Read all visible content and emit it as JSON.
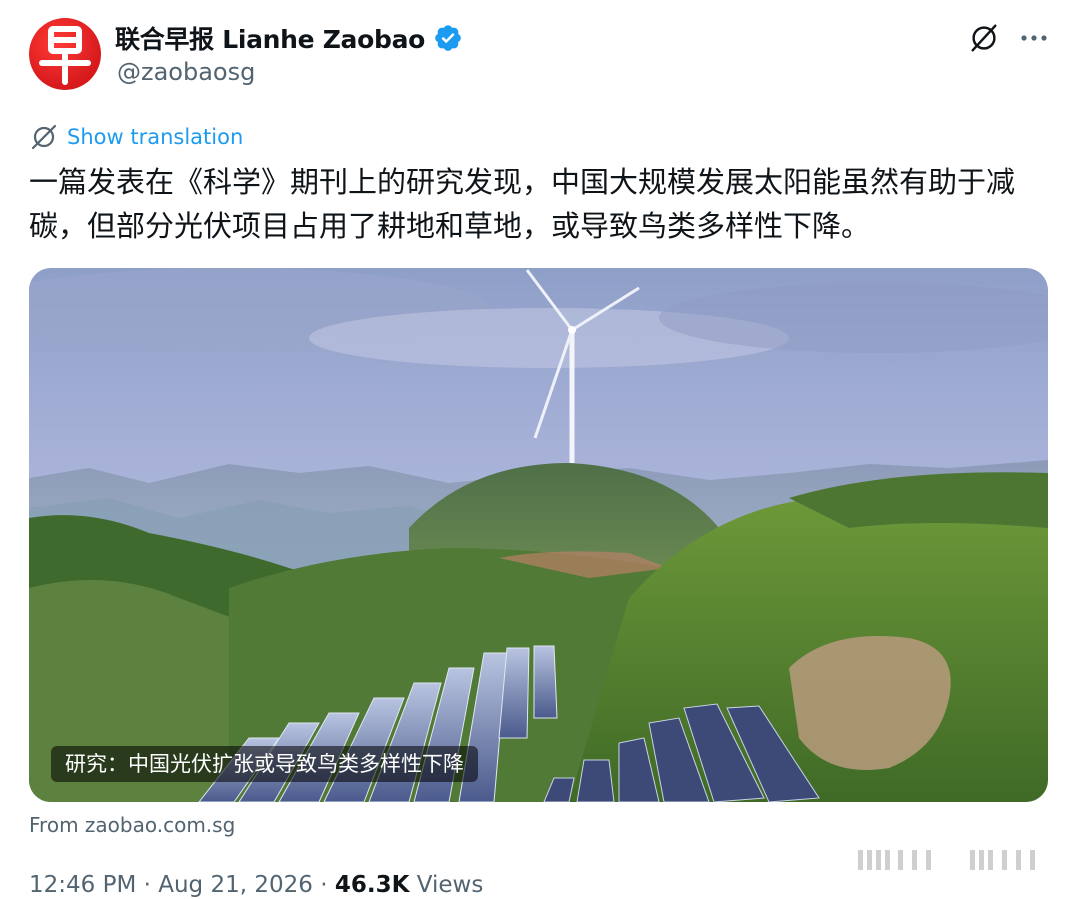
{
  "author": {
    "display_name": "联合早报 Lianhe Zaobao",
    "handle": "@zaobaosg",
    "avatar_glyph": "早",
    "verified": true,
    "avatar_color": "#d7191c"
  },
  "actions": {
    "grok_icon": "grok-slash-icon",
    "more_label": "···"
  },
  "translation": {
    "label": "Show translation",
    "icon": "translate-globe-icon",
    "color": "#1d9bf0"
  },
  "tweet": {
    "text": "一篇发表在《科学》期刊上的研究发现，中国大规模发展太阳能虽然有助于减碳，但部分光伏项目占用了耕地和草地，或导致鸟类多样性下降。"
  },
  "media": {
    "caption": "研究：中国光伏扩张或导致鸟类多样性下降",
    "source": "From zaobao.com.sg"
  },
  "meta": {
    "time": "12:46 PM",
    "separator": " · ",
    "date": "Aug 21, 2026",
    "views_count": "46.3K",
    "views_label": "Views"
  },
  "colors": {
    "text_primary": "#0f1419",
    "text_secondary": "#536471",
    "link": "#1d9bf0"
  }
}
